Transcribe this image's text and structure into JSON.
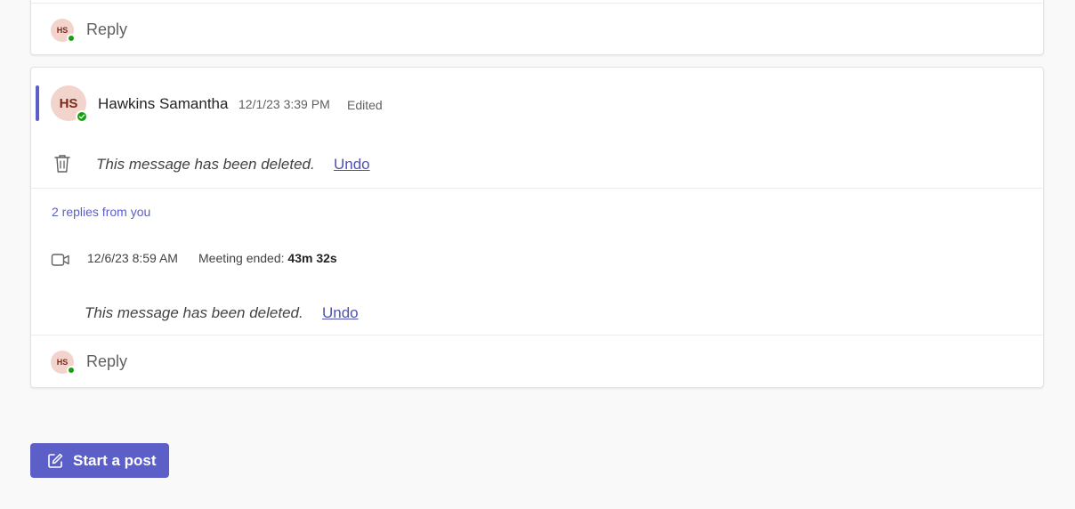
{
  "top_thread": {
    "reply_avatar_initials": "HS",
    "reply_label": "Reply"
  },
  "main_thread": {
    "avatar_initials": "HS",
    "author": "Hawkins Samantha",
    "timestamp": "12/1/23 3:39 PM",
    "edited_label": "Edited",
    "deleted_message": "This message has been deleted.",
    "undo_label": "Undo",
    "replies_link": "2 replies from you",
    "meeting": {
      "timestamp": "12/6/23 8:59 AM",
      "label": "Meeting ended:",
      "duration": "43m 32s"
    },
    "reply_deleted_message": "This message has been deleted.",
    "reply_undo_label": "Undo",
    "reply_avatar_initials": "HS",
    "reply_label": "Reply"
  },
  "compose": {
    "start_post_label": "Start a post"
  },
  "colors": {
    "accent": "#5b5fc7",
    "presence_available": "#13a10e",
    "avatar_bg": "#f2d4cd"
  },
  "icons": [
    "trash-icon",
    "video-camera-icon",
    "compose-icon",
    "presence-check-icon"
  ]
}
